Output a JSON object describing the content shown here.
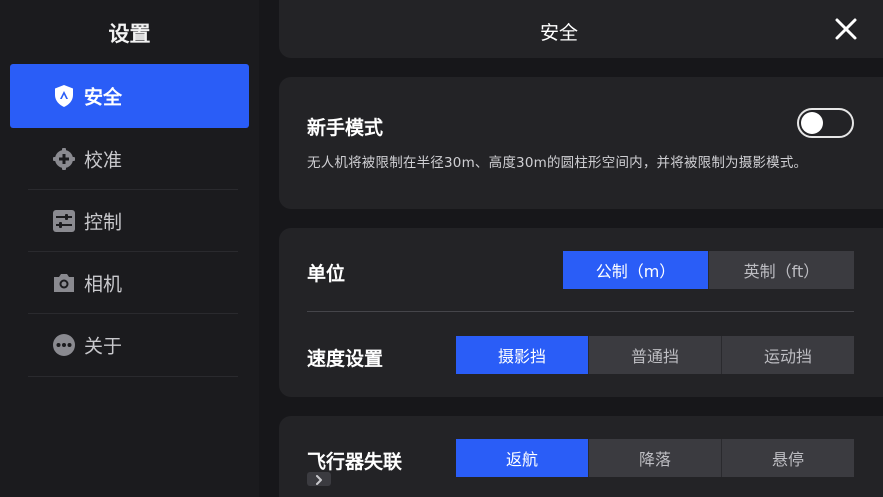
{
  "sidebar": {
    "title": "设置",
    "items": [
      {
        "label": "安全",
        "icon": "shield-icon",
        "active": true
      },
      {
        "label": "校准",
        "icon": "calibration-icon",
        "active": false
      },
      {
        "label": "控制",
        "icon": "sliders-icon",
        "active": false
      },
      {
        "label": "相机",
        "icon": "camera-icon",
        "active": false
      },
      {
        "label": "关于",
        "icon": "more-dots-icon",
        "active": false
      }
    ]
  },
  "header": {
    "title": "安全",
    "close_icon": "close-icon"
  },
  "beginner_mode": {
    "title": "新手模式",
    "enabled": false,
    "description": "无人机将被限制在半径30m、高度30m的圆柱形空间内，并将被限制为摄影模式。"
  },
  "units": {
    "title": "单位",
    "options": [
      "公制（m）",
      "英制（ft）"
    ],
    "selected": 0
  },
  "speed": {
    "title": "速度设置",
    "options": [
      "摄影挡",
      "普通挡",
      "运动挡"
    ],
    "selected": 0
  },
  "lost_connection": {
    "title": "飞行器失联",
    "options": [
      "返航",
      "降落",
      "悬停"
    ],
    "selected": 0,
    "expand_icon": "chevron-right-icon"
  },
  "colors": {
    "accent": "#2a5df7",
    "background": "#17171a",
    "card": "#232326",
    "segment_inactive": "#3b3b40"
  }
}
